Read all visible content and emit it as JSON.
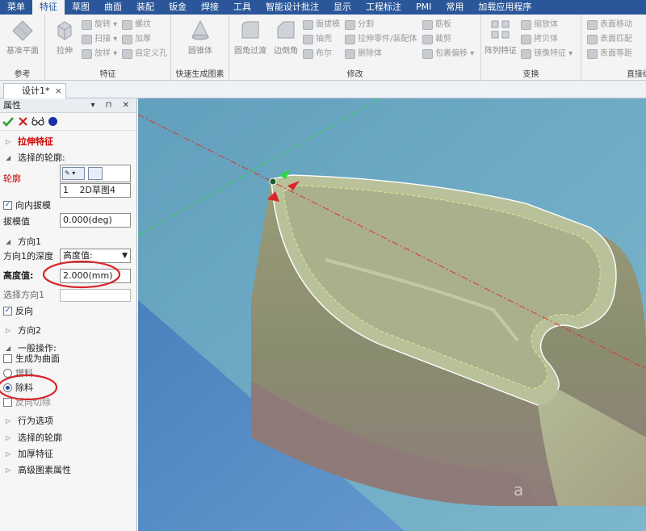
{
  "menubar": {
    "items": [
      "菜单",
      "特征",
      "草图",
      "曲面",
      "装配",
      "钣金",
      "焊接",
      "工具",
      "智能设计批注",
      "显示",
      "工程标注",
      "PMI",
      "常用",
      "加载应用程序"
    ],
    "active_index": 1
  },
  "ribbon": {
    "ref_group": {
      "label": "参考",
      "base_plane": "基准平面"
    },
    "feature_group": {
      "label": "特征",
      "extrude": "拉伸",
      "revolve": "旋转",
      "sweep": "扫描",
      "loft": "放样",
      "thread": "螺纹",
      "thicken": "加厚",
      "custom_hole": "自定义孔"
    },
    "quick_group": {
      "label": "快速生成图素",
      "cone": "圆锥体"
    },
    "modify_group": {
      "label": "修改",
      "fillet": "圆角过渡",
      "chamfer": "边倒角",
      "draft": "面拔模",
      "shell": "抽壳",
      "boolean": "布尔",
      "split": "分割",
      "extrude_part": "拉伸零件/装配体",
      "delete": "删除体",
      "rib": "筋板",
      "trim": "裁剪",
      "wrap": "包裹偏移"
    },
    "transform_group": {
      "label": "变换",
      "pattern": "阵列特征",
      "scale": "缩放体",
      "copy": "拷贝体",
      "mirror": "镜像特征"
    },
    "direct_group": {
      "label": "直接编辑",
      "move_face": "表面移动",
      "match_face": "表面匹配",
      "equal_face": "表面等距"
    }
  },
  "doc_tab": {
    "title": "设计1*",
    "close": "×"
  },
  "panel": {
    "title": "属性",
    "header_controls": "▾ ⊓ ✕",
    "rows": {
      "extrude_feature": "拉伸特征",
      "selected_profile": "选择的轮廓:",
      "profile_label": "轮廓",
      "profile_item_index": "1",
      "profile_item_name": "2D草图4",
      "inward_draft": "向内拔模",
      "draft_value_label": "拔模值",
      "draft_value": "0.000(deg)",
      "direction1": "方向1",
      "direction1_depth_label": "方向1的深度",
      "direction1_depth_value": "高度值:",
      "height_label": "高度值:",
      "height_value": "2.000(mm)",
      "select_direction1": "选择方向1",
      "reverse": "反向",
      "direction2": "方向2",
      "general_op": "一般操作:",
      "make_surface": "生成为曲面",
      "add_material": "增料",
      "remove_material": "除料",
      "reverse_cut": "反向切除",
      "behavior_options": "行为选项",
      "selected_profile2": "选择的轮廓",
      "thicken_feature": "加厚特征",
      "advanced_props": "高级图素属性"
    },
    "inward_draft_checked": true,
    "reverse_checked": true,
    "make_surface_checked": false,
    "reverse_cut_checked": false,
    "op_selected": "remove_material"
  },
  "colors": {
    "menubar_bg": "#2b579a",
    "viewport_bg": "#5d8fc6",
    "annotation_red": "#d9262a",
    "accept_green": "#2e9e2e"
  }
}
